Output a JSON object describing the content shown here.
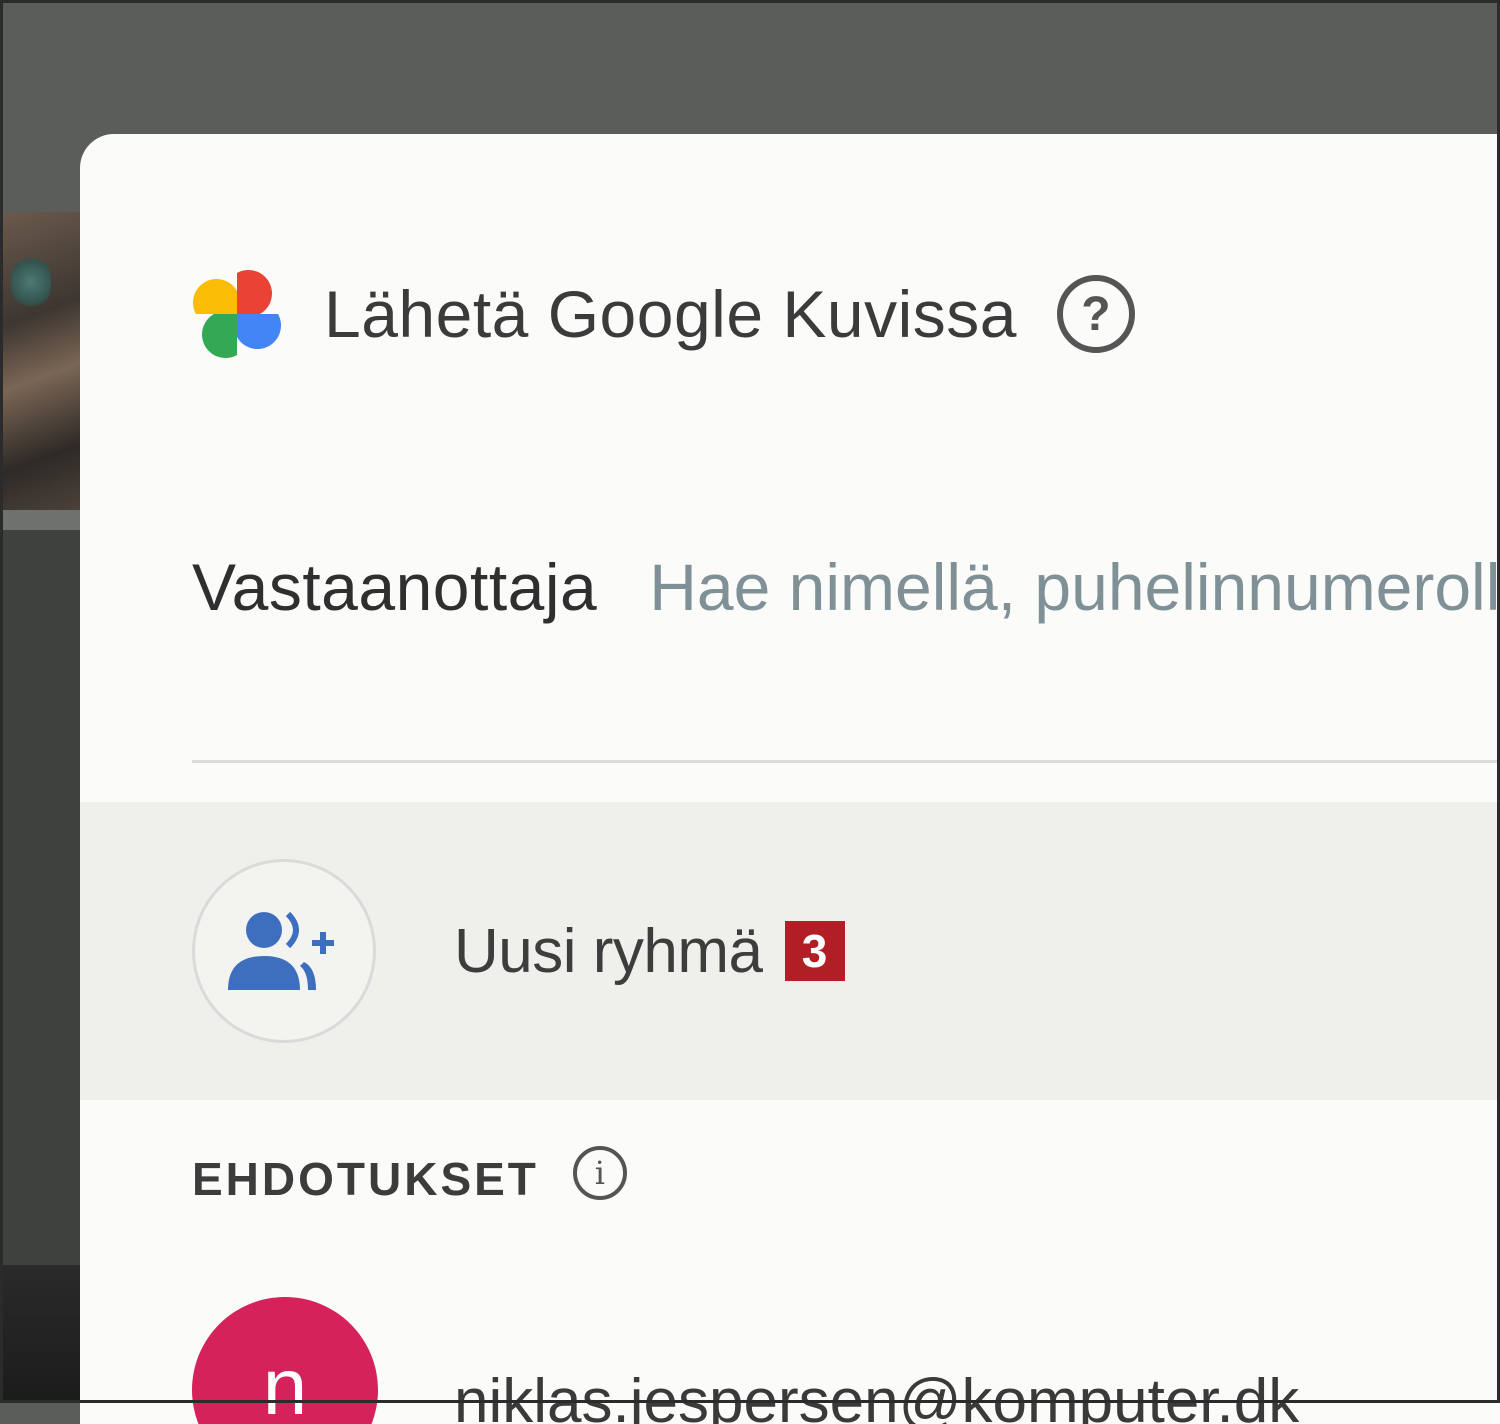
{
  "dialog": {
    "title": "Lähetä Google Kuvissa",
    "help_icon": "help-circle-icon",
    "logo_icon": "google-photos-pinwheel-icon",
    "logo_colors": [
      "#fbbc05",
      "#ea4335",
      "#4285f4",
      "#34a853"
    ]
  },
  "recipient": {
    "label": "Vastaanottaja",
    "placeholder": "Hae nimellä, puhelinnumerolla tai sähköpostilla"
  },
  "new_group": {
    "icon": "add-group-icon",
    "label": "Uusi ryhmä",
    "badge": "3",
    "badge_color": "#b11e26"
  },
  "suggestions": {
    "heading": "EHDOTUKSET",
    "info_icon": "info-icon",
    "contacts": [
      {
        "initial": "n",
        "email": "niklas.jespersen@komputer.dk",
        "avatar_color": "#d6225a"
      }
    ]
  }
}
